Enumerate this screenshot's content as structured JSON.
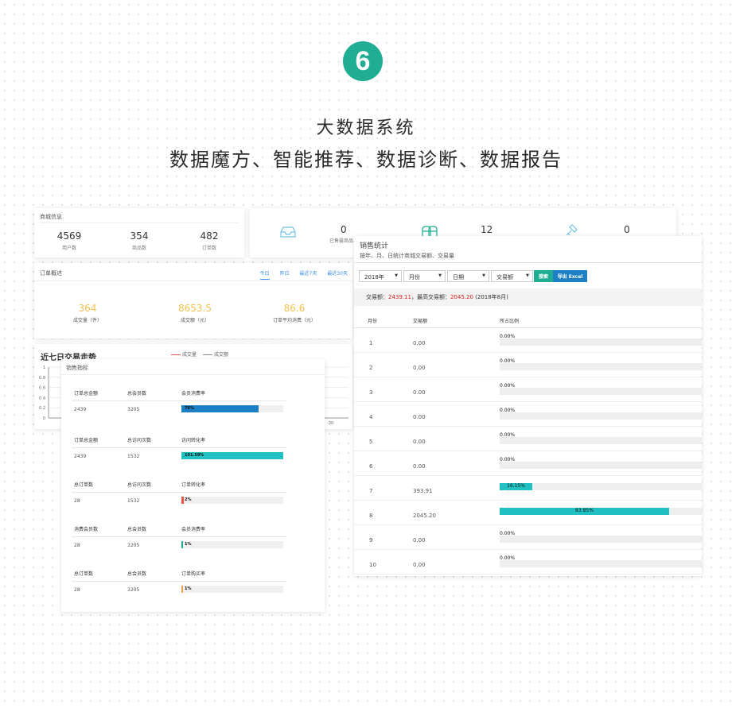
{
  "badge": "6",
  "heading": "大数据系统",
  "subheading": "数据魔方、智能推荐、数据诊断、数据报告",
  "shop_info": {
    "title": "商城信息",
    "stats": [
      {
        "value": "4569",
        "label": "用户数"
      },
      {
        "value": "354",
        "label": "商品数"
      },
      {
        "value": "482",
        "label": "订单数"
      }
    ]
  },
  "top_strip": {
    "items": [
      {
        "icon": "inbox-icon",
        "value": "0",
        "label": "已售罄商品"
      },
      {
        "icon": "users-icon",
        "value": "12",
        "label": ""
      },
      {
        "icon": "tag-icon",
        "value": "0",
        "label": ""
      }
    ]
  },
  "order_overview": {
    "title": "订单概述",
    "tabs": [
      "今日",
      "昨日",
      "最近7天",
      "最近30天"
    ],
    "stats": [
      {
        "value": "364",
        "label": "成交量（件）"
      },
      {
        "value": "8653.5",
        "label": "成交额（元）"
      },
      {
        "value": "86.6",
        "label": "订单平均消费（元）"
      }
    ]
  },
  "trend": {
    "title": "近七日交易走势",
    "legend": [
      "成交量",
      "成交额"
    ],
    "y_ticks": [
      "1",
      "0.8",
      "0.6",
      "0.4",
      "0.2",
      "0"
    ],
    "x_tick_visible": "-30"
  },
  "indicators": {
    "title": "销售指标",
    "rows": [
      {
        "h1": "订单总金额",
        "h2": "总会员数",
        "h3": "会员消费率",
        "v1": "2439",
        "v2": "3205",
        "pct": 76,
        "pct_label": "76%",
        "color": "#1d7fc4"
      },
      {
        "h1": "订单总金额",
        "h2": "总访问次数",
        "h3": "访问转化率",
        "v1": "2439",
        "v2": "1532",
        "pct": 100,
        "pct_label": "101.59%",
        "color": "#21c1c3"
      },
      {
        "h1": "总订单数",
        "h2": "总访问次数",
        "h3": "订单转化率",
        "v1": "28",
        "v2": "1532",
        "pct": 2,
        "pct_label": "2%",
        "color": "#e8534a"
      },
      {
        "h1": "消费会员数",
        "h2": "总会员数",
        "h3": "会员消费率",
        "v1": "28",
        "v2": "3205",
        "pct": 1,
        "pct_label": "1%",
        "color": "#1fae93"
      },
      {
        "h1": "总订单数",
        "h2": "总会员数",
        "h3": "订单购买率",
        "v1": "28",
        "v2": "3205",
        "pct": 1,
        "pct_label": "1%",
        "color": "#f0a04b"
      }
    ]
  },
  "sales_stats": {
    "title": "销售统计",
    "subtitle": "按年、月、日统计商城交易额、交易量",
    "filters": {
      "year": "2018年",
      "month": "月份",
      "date": "日期",
      "metric": "交易额"
    },
    "search_label": "搜索",
    "export_label": "导出 Excel",
    "summary_prefix": "交易额：",
    "summary_total": "2439.11",
    "summary_mid": "，最高交易额：",
    "summary_max": "2045.20",
    "summary_suffix": "(2018年8月)",
    "columns": [
      "月份",
      "交易额",
      "所占比例"
    ],
    "rows": [
      {
        "month": "1",
        "amount": "0.00",
        "pct": 0,
        "pct_label": "0.00%"
      },
      {
        "month": "2",
        "amount": "0.00",
        "pct": 0,
        "pct_label": "0.00%"
      },
      {
        "month": "3",
        "amount": "0.00",
        "pct": 0,
        "pct_label": "0.00%"
      },
      {
        "month": "4",
        "amount": "0.00",
        "pct": 0,
        "pct_label": "0.00%"
      },
      {
        "month": "5",
        "amount": "0.00",
        "pct": 0,
        "pct_label": "0.00%"
      },
      {
        "month": "6",
        "amount": "0.00",
        "pct": 0,
        "pct_label": "0.00%"
      },
      {
        "month": "7",
        "amount": "393.91",
        "pct": 16.15,
        "pct_label": "16.15%"
      },
      {
        "month": "8",
        "amount": "2045.20",
        "pct": 83.85,
        "pct_label": "83.85%"
      },
      {
        "month": "9",
        "amount": "0.00",
        "pct": 0,
        "pct_label": "0.00%"
      },
      {
        "month": "10",
        "amount": "0.00",
        "pct": 0,
        "pct_label": "0.00%"
      }
    ]
  }
}
